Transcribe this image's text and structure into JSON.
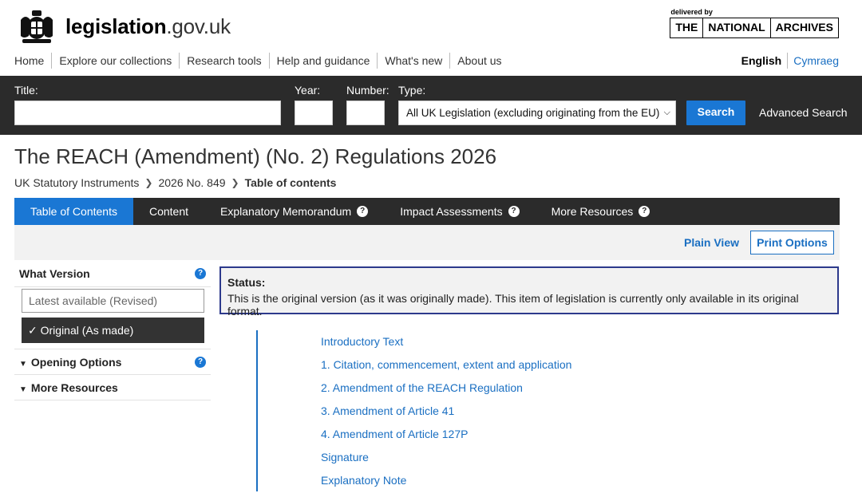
{
  "header": {
    "logo_main": "legislation",
    "logo_domain": ".gov.uk",
    "tna_delivered_by": "delivered by",
    "tna_words": [
      "THE",
      "NATIONAL",
      "ARCHIVES"
    ]
  },
  "topnav": [
    "Home",
    "Explore our collections",
    "Research tools",
    "Help and guidance",
    "What's new",
    "About us"
  ],
  "language": {
    "english": "English",
    "welsh": "Cymraeg"
  },
  "search": {
    "title_label": "Title:",
    "title_value": "",
    "year_label": "Year:",
    "year_value": "",
    "number_label": "Number:",
    "number_value": "",
    "type_label": "Type:",
    "type_selected": "All UK Legislation (excluding originating from the EU)",
    "search_button": "Search",
    "advanced": "Advanced Search"
  },
  "page": {
    "title": "The REACH (Amendment) (No. 2) Regulations 2026",
    "breadcrumb": [
      "UK Statutory Instruments",
      "2026 No. 849",
      "Table of contents"
    ]
  },
  "tabs": [
    {
      "label": "Table of Contents",
      "active": true,
      "help": false
    },
    {
      "label": "Content",
      "active": false,
      "help": false
    },
    {
      "label": "Explanatory Memorandum",
      "active": false,
      "help": true
    },
    {
      "label": "Impact Assessments",
      "active": false,
      "help": true
    },
    {
      "label": "More Resources",
      "active": false,
      "help": true
    }
  ],
  "toolbar": {
    "plain_view": "Plain View",
    "print_options": "Print Options"
  },
  "sidebar": {
    "what_version": "What Version",
    "latest": "Latest available (Revised)",
    "original": "✓ Original (As made)",
    "opening_options": "Opening Options",
    "more_resources": "More Resources"
  },
  "status": {
    "title": "Status:",
    "text": "This is the original version (as it was originally made). This item of legislation is currently only available in its original format."
  },
  "toc": [
    "Introductory Text",
    "1. Citation, commencement, extent and application",
    "2. Amendment of the REACH Regulation",
    "3. Amendment of Article 41",
    "4. Amendment of Article 127P",
    "Signature",
    "Explanatory Note"
  ],
  "colors": {
    "accent": "#1a77d4",
    "dark_bar": "#2b2b2b",
    "link": "#1a6fc2",
    "status_border": "#2d3a8c"
  }
}
